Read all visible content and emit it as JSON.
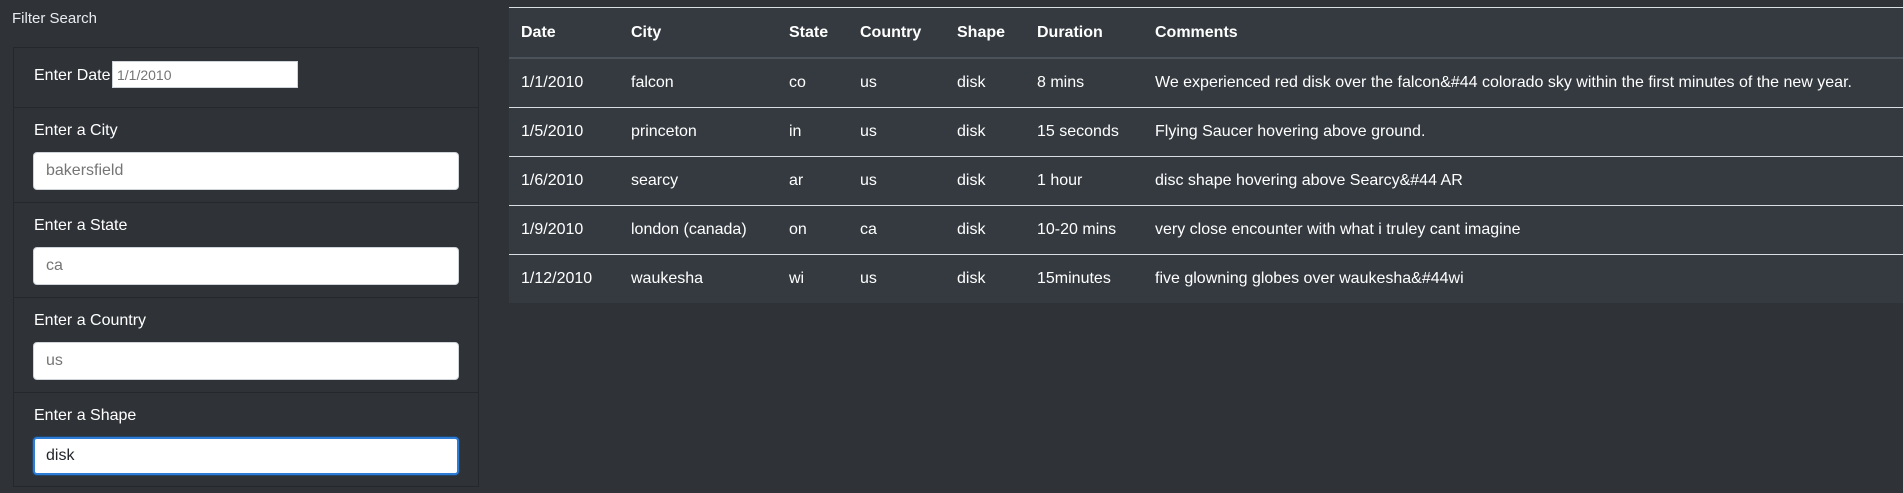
{
  "filter": {
    "title": "Filter Search",
    "date": {
      "label": "Enter Date",
      "placeholder": "1/1/2010",
      "value": ""
    },
    "city": {
      "label": "Enter a City",
      "placeholder": "bakersfield",
      "value": ""
    },
    "state": {
      "label": "Enter a State",
      "placeholder": "ca",
      "value": ""
    },
    "country": {
      "label": "Enter a Country",
      "placeholder": "us",
      "value": ""
    },
    "shape": {
      "label": "Enter a Shape",
      "placeholder": "",
      "value": "disk"
    }
  },
  "table": {
    "headers": {
      "date": "Date",
      "city": "City",
      "state": "State",
      "country": "Country",
      "shape": "Shape",
      "duration": "Duration",
      "comments": "Comments"
    },
    "rows": [
      {
        "date": "1/1/2010",
        "city": "falcon",
        "state": "co",
        "country": "us",
        "shape": "disk",
        "duration": "8 mins",
        "comments": "We experienced red disk over the falcon&#44 colorado sky within the first minutes of the new year."
      },
      {
        "date": "1/5/2010",
        "city": "princeton",
        "state": "in",
        "country": "us",
        "shape": "disk",
        "duration": "15 seconds",
        "comments": "Flying Saucer hovering above ground."
      },
      {
        "date": "1/6/2010",
        "city": "searcy",
        "state": "ar",
        "country": "us",
        "shape": "disk",
        "duration": "1 hour",
        "comments": "disc shape hovering above Searcy&#44 AR"
      },
      {
        "date": "1/9/2010",
        "city": "london (canada)",
        "state": "on",
        "country": "ca",
        "shape": "disk",
        "duration": "10-20 mins",
        "comments": "very close encounter with what i truley cant imagine"
      },
      {
        "date": "1/12/2010",
        "city": "waukesha",
        "state": "wi",
        "country": "us",
        "shape": "disk",
        "duration": "15minutes",
        "comments": "five glowning globes over waukesha&#44wi"
      }
    ]
  }
}
